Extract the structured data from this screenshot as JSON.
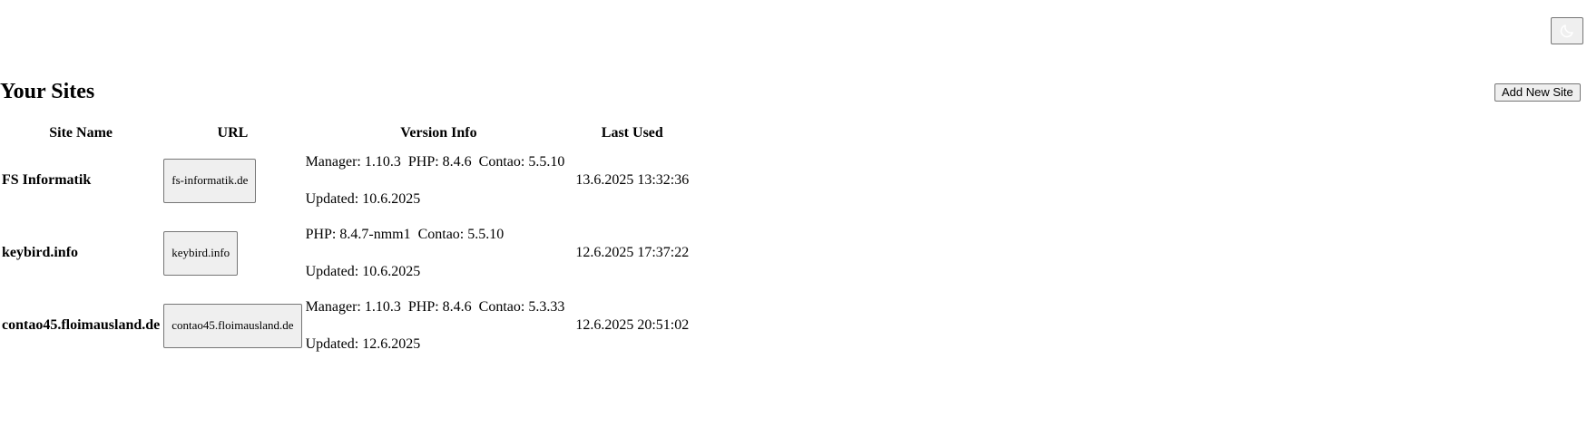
{
  "header": {
    "theme_toggle_icon": "moon-icon"
  },
  "page": {
    "title": "Your Sites",
    "add_button_label": "Add New Site"
  },
  "table": {
    "headers": [
      "Site Name",
      "URL",
      "Version Info",
      "Last Used"
    ],
    "rows": [
      {
        "name": "FS Informatik",
        "url": "fs-informatik.de",
        "versions": [
          "Manager: 1.10.3",
          "PHP: 8.4.6",
          "Contao: 5.5.10"
        ],
        "updated": "Updated: 10.6.2025",
        "last_used": "13.6.2025 13:32:36"
      },
      {
        "name": "keybird.info",
        "url": "keybird.info",
        "versions": [
          "PHP: 8.4.7-nmm1",
          "Contao: 5.5.10"
        ],
        "updated": "Updated: 10.6.2025",
        "last_used": "12.6.2025 17:37:22"
      },
      {
        "name": "contao45.floimausland.de",
        "url": "contao45.floimausland.de",
        "versions": [
          "Manager: 1.10.3",
          "PHP: 8.4.6",
          "Contao: 5.3.33"
        ],
        "updated": "Updated: 12.6.2025",
        "last_used": "12.6.2025 20:51:02"
      }
    ]
  }
}
